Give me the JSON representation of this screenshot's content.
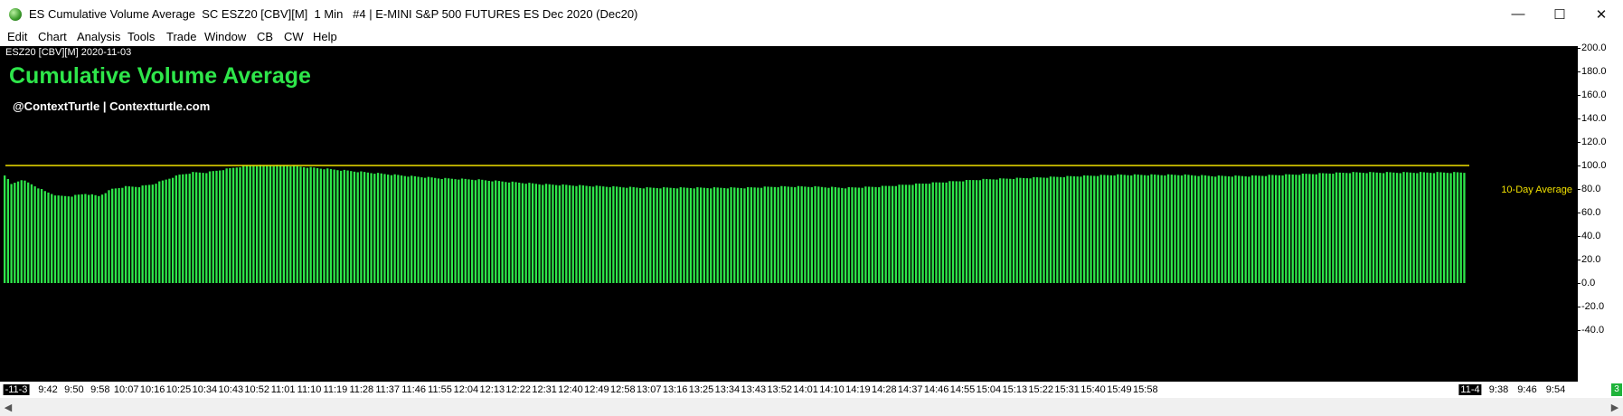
{
  "window": {
    "title": "ES Cumulative Volume Average  SC ESZ20 [CBV][M]  1 Min   #4 | E-MINI S&P 500 FUTURES ES Dec 2020 (Dec20)",
    "minimize_glyph": "—",
    "maximize_glyph": "☐",
    "close_glyph": "✕"
  },
  "menu": [
    "Edit",
    "Chart",
    "Analysis",
    "Tools",
    "Trade",
    "Window",
    "CB",
    "CW",
    "Help"
  ],
  "chart": {
    "symbol_label": "ESZ20 [CBV][M] 2020-11-03",
    "title": "Cumulative Volume Average",
    "subtitle": "@ContextTurtle | Contextturtle.com",
    "reference_label": "10-Day Average",
    "colors": {
      "background": "#000000",
      "bars": "#2ee64a",
      "reference": "#f0e000",
      "title": "#2ee64a"
    },
    "status_badge": "3"
  },
  "chart_data": {
    "type": "bar",
    "title": "Cumulative Volume Average",
    "series": [
      {
        "name": "10-Day Average",
        "value": 100.0
      }
    ],
    "ylim": [
      -40,
      200
    ],
    "yticks": [
      "200.0",
      "180.0",
      "160.0",
      "140.0",
      "120.0",
      "100.0",
      "80.0",
      "60.0",
      "40.0",
      "20.0",
      "0.0",
      "-20.0",
      "-40.0"
    ],
    "xticks": [
      "-11-3",
      "9:42",
      "9:50",
      "9:58",
      "10:07",
      "10:16",
      "10:25",
      "10:34",
      "10:43",
      "10:52",
      "11:01",
      "11:10",
      "11:19",
      "11:28",
      "11:37",
      "11:46",
      "11:55",
      "12:04",
      "12:13",
      "12:22",
      "12:31",
      "12:40",
      "12:49",
      "12:58",
      "13:07",
      "13:16",
      "13:25",
      "13:34",
      "13:43",
      "13:52",
      "14:01",
      "14:10",
      "14:19",
      "14:28",
      "14:37",
      "14:46",
      "14:55",
      "15:04",
      "15:13",
      "15:22",
      "15:31",
      "15:40",
      "15:49",
      "15:58",
      "11-4",
      "9:38",
      "9:46",
      "9:54"
    ],
    "boxed_ticks": [
      "-11-3",
      "11-4"
    ],
    "profile_keypoints": [
      [
        0,
        92
      ],
      [
        2,
        84
      ],
      [
        5,
        88
      ],
      [
        8,
        84
      ],
      [
        12,
        78
      ],
      [
        16,
        74
      ],
      [
        20,
        74
      ],
      [
        24,
        76
      ],
      [
        28,
        74
      ],
      [
        32,
        80
      ],
      [
        36,
        82
      ],
      [
        40,
        82
      ],
      [
        44,
        84
      ],
      [
        48,
        88
      ],
      [
        52,
        92
      ],
      [
        56,
        94
      ],
      [
        60,
        94
      ],
      [
        64,
        96
      ],
      [
        68,
        98
      ],
      [
        72,
        100
      ],
      [
        76,
        100
      ],
      [
        80,
        100
      ],
      [
        84,
        100
      ],
      [
        88,
        99
      ],
      [
        92,
        98
      ],
      [
        96,
        97
      ],
      [
        100,
        96
      ],
      [
        104,
        95
      ],
      [
        108,
        94
      ],
      [
        112,
        93
      ],
      [
        116,
        92
      ],
      [
        120,
        91
      ],
      [
        130,
        89
      ],
      [
        140,
        88
      ],
      [
        150,
        86
      ],
      [
        160,
        84
      ],
      [
        170,
        83
      ],
      [
        180,
        82
      ],
      [
        190,
        81
      ],
      [
        200,
        81
      ],
      [
        210,
        81
      ],
      [
        220,
        81
      ],
      [
        230,
        82
      ],
      [
        240,
        82
      ],
      [
        250,
        81
      ],
      [
        260,
        82
      ],
      [
        270,
        84
      ],
      [
        280,
        86
      ],
      [
        290,
        88
      ],
      [
        300,
        89
      ],
      [
        310,
        90
      ],
      [
        320,
        91
      ],
      [
        330,
        92
      ],
      [
        340,
        92
      ],
      [
        350,
        92
      ],
      [
        360,
        91
      ],
      [
        370,
        91
      ],
      [
        380,
        92
      ],
      [
        390,
        93
      ],
      [
        400,
        94
      ],
      [
        410,
        94
      ],
      [
        420,
        94
      ],
      [
        430,
        94
      ],
      [
        434,
        94
      ]
    ],
    "bar_count": 435
  }
}
